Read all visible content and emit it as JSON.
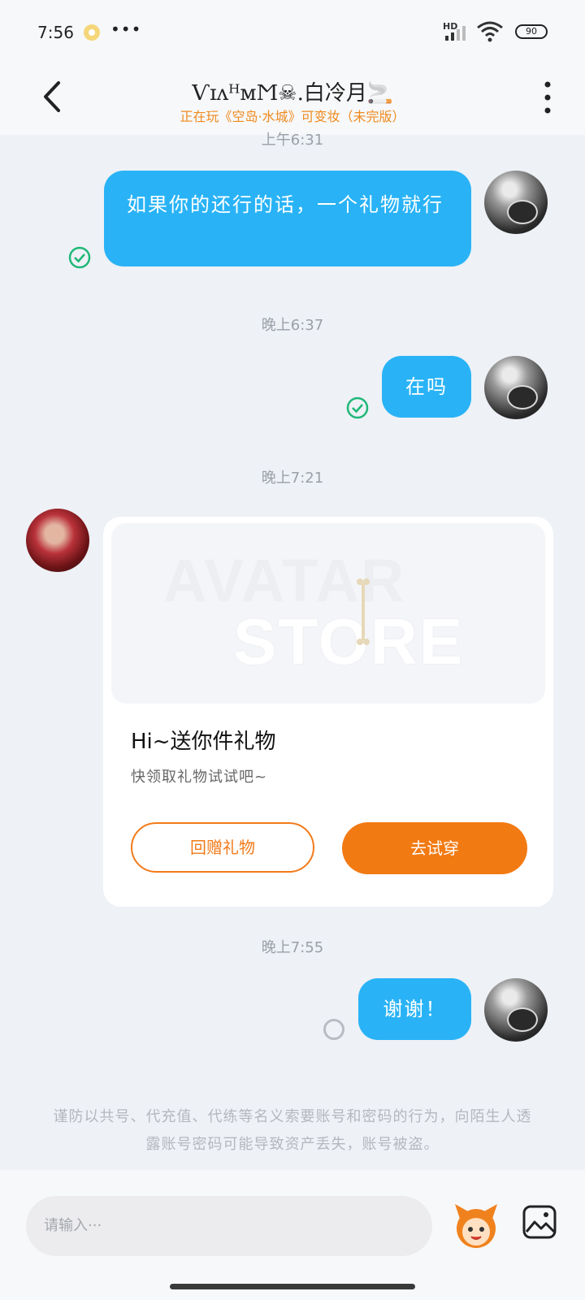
{
  "status_bar": {
    "time": "7:56",
    "more": "•••",
    "network": "HD",
    "battery": "90"
  },
  "header": {
    "title": "ѴɪᴧᴴᴍϺ☠.白冷月🚬",
    "subtitle": "正在玩《空岛·水城》可变妆（未完版）",
    "back_icon": "chevron-left-icon",
    "menu_icon": "vertical-dots-icon"
  },
  "messages": [
    {
      "time": "上午6:31",
      "text": "如果你的还行的话，一个礼物就行",
      "status": "read"
    },
    {
      "time": "晚上6:37",
      "text": "在吗",
      "status": "read"
    },
    {
      "time": "晚上7:21"
    },
    {
      "time": "晚上7:55",
      "text": "谢谢！",
      "status": "sending"
    }
  ],
  "gift_card": {
    "banner_line1": "AVATAR",
    "banner_line2": "STORE",
    "title": "Hi~送你件礼物",
    "description": "快领取礼物试试吧~",
    "gift_button": "回赠礼物",
    "try_button": "去试穿"
  },
  "notice": "谨防以共号、代充值、代练等名义索要账号和密码的行为，向陌生人透露账号密码可能导致资产丢失，账号被盗。",
  "input": {
    "placeholder": "请输入···"
  },
  "colors": {
    "bubble": "#29b3f6",
    "accent_orange": "#f27a12",
    "read_check": "#1fb877"
  }
}
